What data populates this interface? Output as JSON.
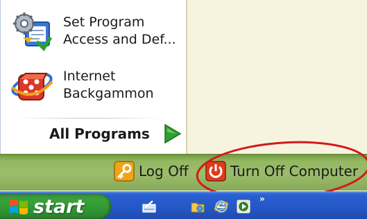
{
  "start_menu": {
    "programs": [
      {
        "line1": "Set Program",
        "line2": "Access and Def...",
        "icon": "set-program-access-icon"
      },
      {
        "line1": "Internet",
        "line2": "Backgammon",
        "icon": "backgammon-icon"
      }
    ],
    "all_programs_label": "All Programs",
    "all_programs_icon": "green-arrow-right-icon"
  },
  "logoff_bar": {
    "log_off_label": "Log Off",
    "log_off_icon": "key-icon",
    "turn_off_label": "Turn Off Computer",
    "turn_off_icon": "power-icon"
  },
  "annotation": {
    "shape": "red-ellipse",
    "color": "#d11a1a"
  },
  "taskbar": {
    "start_label": "start",
    "start_icon": "windows-flag-icon",
    "quick_launch": [
      "show-desktop-icon",
      "explorer-folder-icon",
      "internet-explorer-icon",
      "media-player-icon"
    ],
    "overflow_label": "»"
  },
  "colors": {
    "logoff_bar": "#94b762",
    "taskbar": "#2456c4",
    "start_button": "#37a33a",
    "right_pane": "#f6f3df"
  }
}
